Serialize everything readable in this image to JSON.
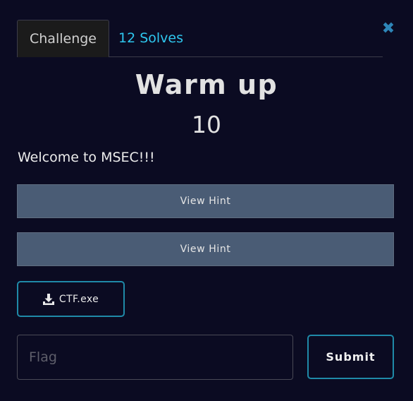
{
  "tabs": {
    "challenge": "Challenge",
    "solves": "12 Solves"
  },
  "challenge": {
    "title": "Warm up",
    "points": "10",
    "description": "Welcome to MSEC!!!"
  },
  "hints": [
    {
      "label": "View Hint"
    },
    {
      "label": "View Hint"
    }
  ],
  "file": {
    "name": "CTF.exe",
    "icon": "download-icon"
  },
  "flag_form": {
    "placeholder": "Flag",
    "value": "",
    "submit_label": "Submit"
  },
  "colors": {
    "background": "#0b0b22",
    "accent": "#2ec7ef",
    "button_border": "#1f8aa8",
    "hint_button": "#4a5c75",
    "close_icon": "#2e86b9"
  }
}
